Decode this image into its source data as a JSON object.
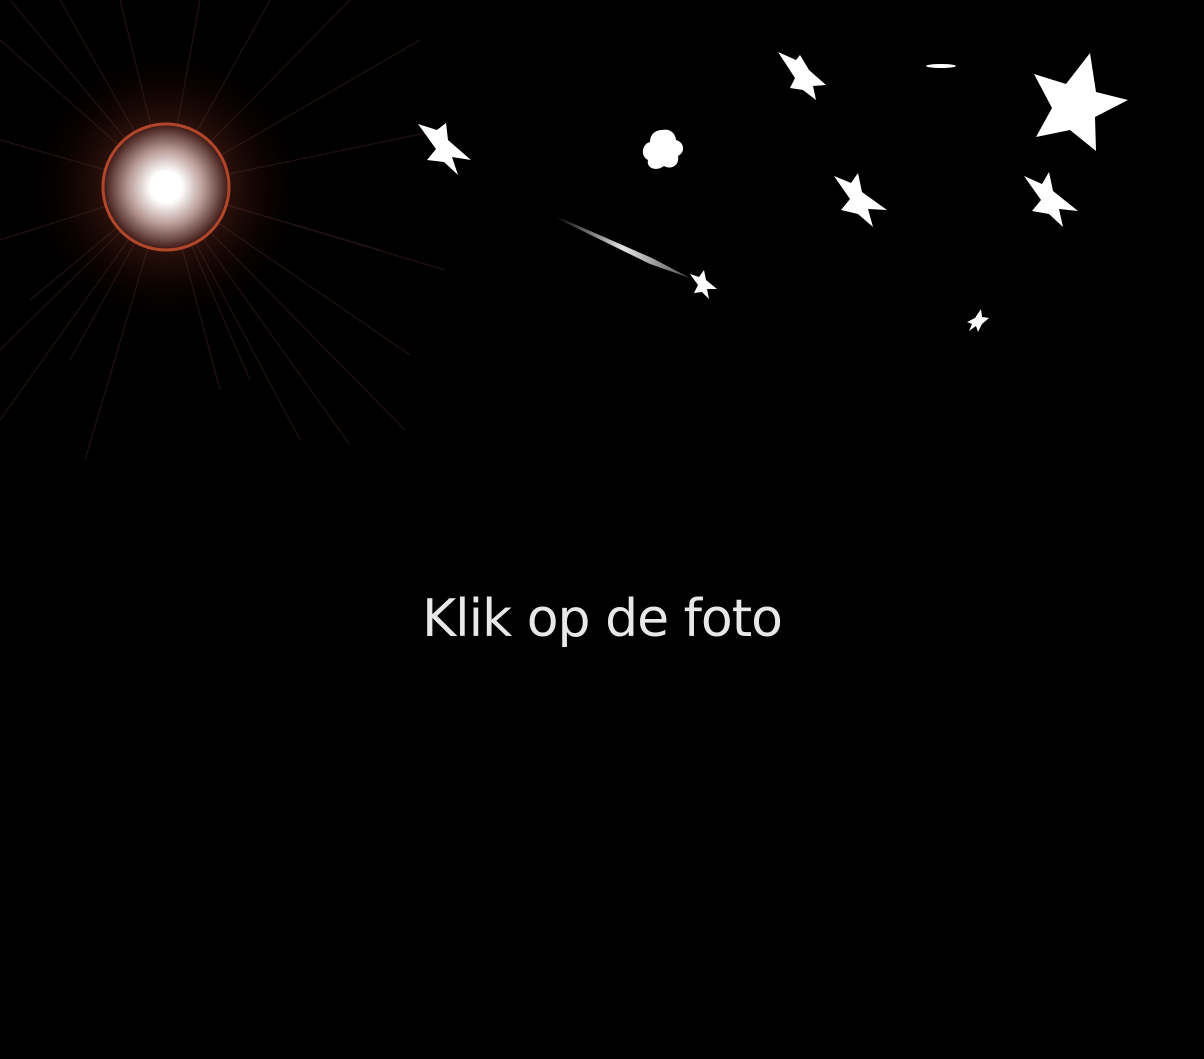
{
  "prompt": {
    "text": "Klik op de foto"
  },
  "colors": {
    "background": "#000000",
    "text": "#e8e8e8",
    "star": "#ffffff",
    "sun_ring": "#b0462a",
    "sun_glow": "#5a1a0e"
  },
  "decorations": {
    "sun": "glowing-sun-icon",
    "stars": "star-icon",
    "shooting_star": "shooting-star-icon",
    "flower": "flower-star-icon"
  }
}
